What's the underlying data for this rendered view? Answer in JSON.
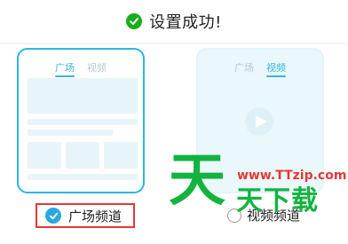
{
  "toast": {
    "icon": "success-check-icon",
    "message": "设置成功!"
  },
  "cards": {
    "square": {
      "tabs": [
        "广场",
        "视频"
      ],
      "active_tab": "广场"
    },
    "video": {
      "tabs": [
        "广场",
        "视频"
      ],
      "active_tab": "视频"
    }
  },
  "options": {
    "square_label": "广场频道",
    "video_label": "视频频道",
    "selected": "广场频道"
  },
  "watermark": {
    "big_char": "天",
    "url": "www.TTzip.com",
    "title": "天下载"
  },
  "colors": {
    "success": "#1aad19",
    "accent": "#2aa8e0",
    "highlight_border": "#e53935",
    "watermark_green": "#14b340"
  }
}
